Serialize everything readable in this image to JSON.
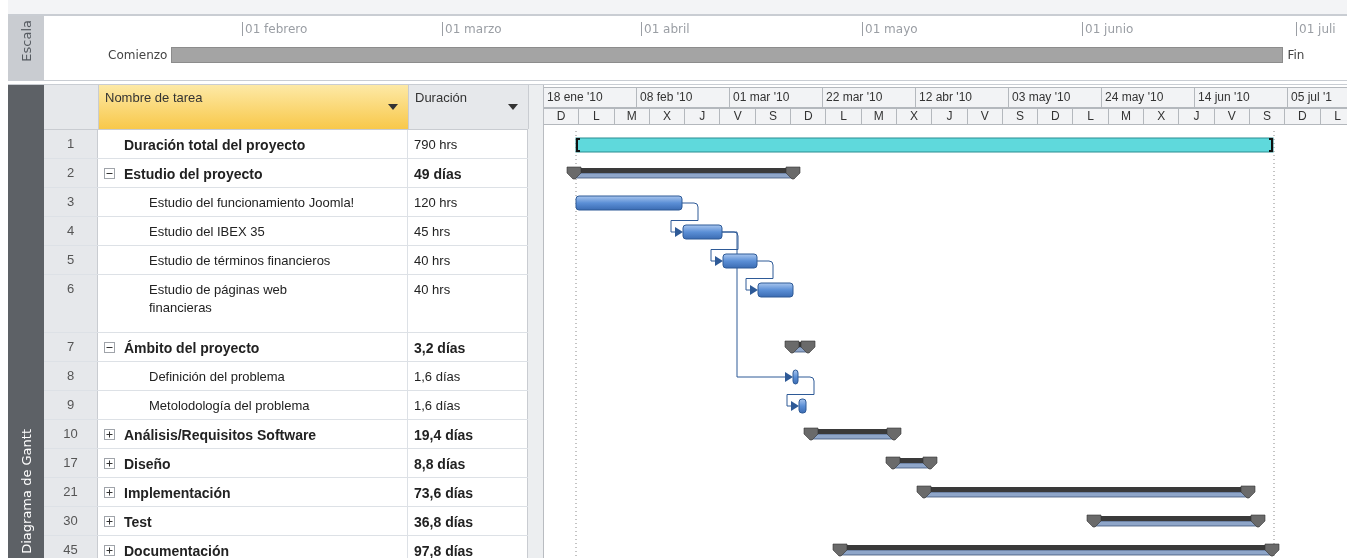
{
  "scale": {
    "label": "Escala",
    "months": [
      "01 febrero",
      "01 marzo",
      "01 abril",
      "01 mayo",
      "01 junio",
      "01 juli"
    ],
    "start_label": "Comienzo",
    "end_label": "Fin"
  },
  "view": {
    "label": "Diagrama de Gantt"
  },
  "columns": [
    {
      "label": "Nombre de tarea",
      "selected": true
    },
    {
      "label": "Duración",
      "selected": false
    }
  ],
  "timescale": {
    "major": [
      "18 ene '10",
      "08 feb '10",
      "01 mar '10",
      "22 mar '10",
      "12 abr '10",
      "03 may '10",
      "24 may '10",
      "14 jun '10",
      "05 jul '1"
    ],
    "minor": [
      "D",
      "L",
      "M",
      "X",
      "J",
      "V",
      "S",
      "D",
      "L",
      "M",
      "X",
      "J",
      "V",
      "S",
      "D",
      "L",
      "M",
      "X",
      "J",
      "V",
      "S",
      "D",
      "L"
    ]
  },
  "tasks": [
    {
      "id": "1",
      "kind": "project",
      "name": "Duración total del proyecto",
      "duration": "790 hrs"
    },
    {
      "id": "2",
      "kind": "summary",
      "name": "Estudio del proyecto",
      "duration": "49 días",
      "expanded": true,
      "children": [
        {
          "id": "3",
          "kind": "task",
          "name": "Estudio del funcionamiento Joomla!",
          "duration": "120 hrs"
        },
        {
          "id": "4",
          "kind": "task",
          "name": "Estudio del IBEX 35",
          "duration": "45 hrs"
        },
        {
          "id": "5",
          "kind": "task",
          "name": "Estudio de términos financieros",
          "duration": "40 hrs"
        },
        {
          "id": "6",
          "kind": "task",
          "name": "Estudio de páginas web\nfinancieras",
          "duration": "40 hrs"
        }
      ]
    },
    {
      "id": "7",
      "kind": "summary",
      "name": "Ámbito del proyecto",
      "duration": "3,2 días",
      "expanded": true,
      "children": [
        {
          "id": "8",
          "kind": "task",
          "name": "Definición del problema",
          "duration": "1,6 días"
        },
        {
          "id": "9",
          "kind": "task",
          "name": "Metolodología del problema",
          "duration": "1,6 días"
        }
      ]
    },
    {
      "id": "10",
      "kind": "summary",
      "name": "Análisis/Requisitos Software",
      "duration": "19,4 días",
      "expanded": false
    },
    {
      "id": "17",
      "kind": "summary",
      "name": "Diseño",
      "duration": "8,8 días",
      "expanded": false
    },
    {
      "id": "21",
      "kind": "summary",
      "name": "Implementación",
      "duration": "73,6 días",
      "expanded": false
    },
    {
      "id": "30",
      "kind": "summary",
      "name": "Test",
      "duration": "36,8 días",
      "expanded": false
    },
    {
      "id": "45",
      "kind": "summary",
      "name": "Documentación",
      "duration": "97,8 días",
      "expanded": false
    }
  ]
}
